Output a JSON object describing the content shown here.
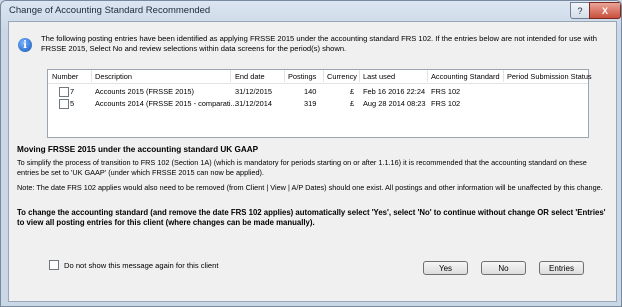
{
  "window": {
    "title": "Change of Accounting Standard Recommended",
    "help_glyph": "?",
    "close_glyph": "X"
  },
  "intro_text": "The following posting entries have been identified as applying FRSSE 2015 under the accounting standard FRS 102. If the entries below are not intended for use with FRSSE 2015, Select No and review selections within data screens for the period(s) shown.",
  "table": {
    "columns": [
      "Number",
      "Description",
      "End date",
      "Postings",
      "Currency",
      "Last used",
      "Accounting Standard",
      "Period Submission Status"
    ],
    "rows": [
      {
        "number": "7",
        "description": "Accounts 2015 (FRSSE 2015)",
        "end_date": "31/12/2015",
        "postings": "140",
        "currency": "£",
        "last_used": "Feb 16 2016 22:24",
        "standard": "FRS 102",
        "status": ""
      },
      {
        "number": "5",
        "description": "Accounts 2014 (FRSSE 2015 - comparati...",
        "end_date": "31/12/2014",
        "postings": "319",
        "currency": "£",
        "last_used": "Aug 28 2014 08:23",
        "standard": "FRS 102",
        "status": ""
      }
    ]
  },
  "heading": "Moving FRSSE 2015 under the accounting standard UK GAAP",
  "para1": "To simplify the process of transition to FRS 102 (Section 1A) (which is mandatory for periods starting on or after 1.1.16) it is recommended that the accounting standard on these entries be set to 'UK GAAP' (under which FRSSE 2015 can now be applied).",
  "para2": "Note: The date FRS 102 applies would also need to be removed (from Client | View | A/P Dates) should one exist. All postings and other information will be unaffected by this change.",
  "para3": "To change the accounting standard (and remove the date FRS 102 applies) automatically select 'Yes', select 'No' to continue without change OR select 'Entries' to view all posting entries for this client (where changes can be made manually).",
  "dont_show_label": "Do not show this message again for this client",
  "buttons": {
    "yes": "Yes",
    "no": "No",
    "entries": "Entries"
  }
}
